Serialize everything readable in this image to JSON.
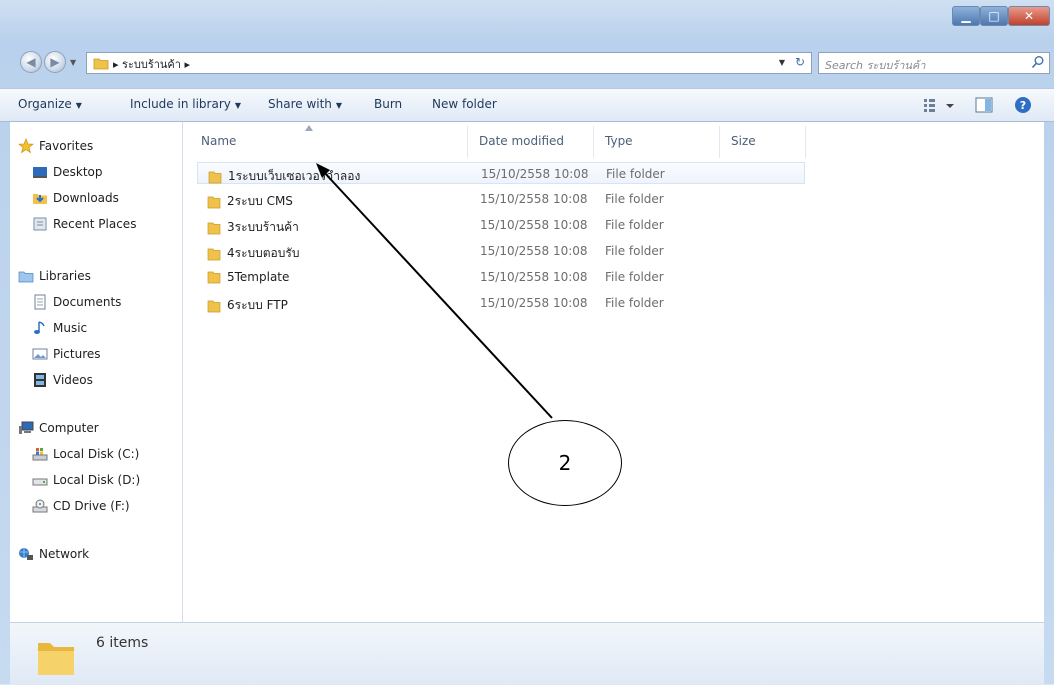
{
  "address": {
    "crumb": "ระบบร้านค้า"
  },
  "search": {
    "placeholder": "Search ระบบร้านค้า"
  },
  "toolbar": {
    "organize": "Organize",
    "include": "Include in library",
    "share": "Share with",
    "burn": "Burn",
    "new_folder": "New folder"
  },
  "nav": {
    "favorites": "Favorites",
    "desktop": "Desktop",
    "downloads": "Downloads",
    "recent": "Recent Places",
    "libraries": "Libraries",
    "documents": "Documents",
    "music": "Music",
    "pictures": "Pictures",
    "videos": "Videos",
    "computer": "Computer",
    "disk_c": "Local Disk (C:)",
    "disk_d": "Local Disk (D:)",
    "cd": "CD Drive (F:)",
    "network": "Network"
  },
  "columns": {
    "name": "Name",
    "date": "Date modified",
    "type": "Type",
    "size": "Size"
  },
  "files": [
    {
      "name": "1ระบบเว็บเซอเวอร์จำลอง",
      "date": "15/10/2558 10:08",
      "type": "File folder"
    },
    {
      "name": "2ระบบ CMS",
      "date": "15/10/2558 10:08",
      "type": "File folder"
    },
    {
      "name": "3ระบบร้านค้า",
      "date": "15/10/2558 10:08",
      "type": "File folder"
    },
    {
      "name": "4ระบบตอบรับ",
      "date": "15/10/2558 10:08",
      "type": "File folder"
    },
    {
      "name": "5Template",
      "date": "15/10/2558 10:08",
      "type": "File folder"
    },
    {
      "name": "6ระบบ FTP",
      "date": "15/10/2558 10:08",
      "type": "File folder"
    }
  ],
  "status": {
    "count": "6 items"
  },
  "annotation": {
    "label": "2"
  }
}
